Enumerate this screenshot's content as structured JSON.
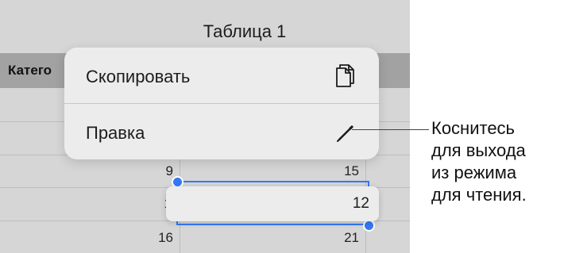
{
  "sheet": {
    "title": "Таблица 1",
    "header_label": "Катего",
    "cells": {
      "r1_col1": "9",
      "r1_col2": "15",
      "r2_col1": "1",
      "r3_col1": "16",
      "r3_col2": "21"
    }
  },
  "edit_field": {
    "value": "12"
  },
  "popup_menu": {
    "items": [
      {
        "label": "Скопировать",
        "icon": "copy-icon"
      },
      {
        "label": "Правка",
        "icon": "pencil-icon"
      }
    ]
  },
  "callout": {
    "lines": [
      "Коснитесь",
      "для выхода",
      "из режима",
      "для чтения."
    ]
  },
  "colors": {
    "sheet_bg": "#d6d6d6",
    "header_bg": "#a2a2a2",
    "popup_bg": "#ececec",
    "selection_accent": "#3478f6"
  }
}
